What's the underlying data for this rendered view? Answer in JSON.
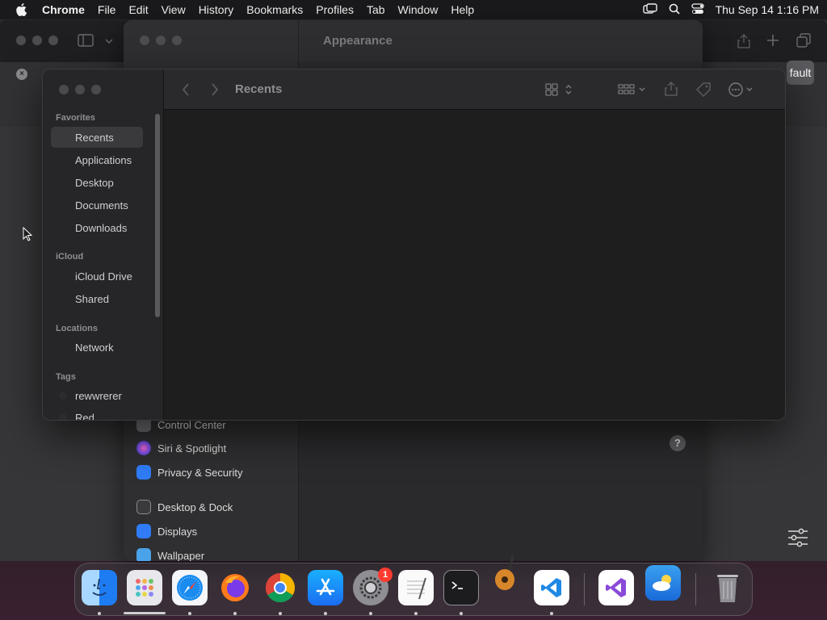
{
  "menubar": {
    "app_name": "Chrome",
    "items": [
      "File",
      "Edit",
      "View",
      "History",
      "Bookmarks",
      "Profiles",
      "Tab",
      "Window",
      "Help"
    ],
    "clock": "Thu Sep 14  1:16 PM"
  },
  "chrome": {
    "partial_button_label": "fault"
  },
  "settings": {
    "title": "Appearance",
    "sidebar_items": [
      {
        "label": "Control Center",
        "icon": "control-center-icon",
        "color": "#6e6e73"
      },
      {
        "label": "Siri & Spotlight",
        "icon": "siri-icon",
        "color": "#b14bd6"
      },
      {
        "label": "Privacy & Security",
        "icon": "hand-icon",
        "color": "#2f7cf6"
      },
      {
        "label": "Desktop & Dock",
        "icon": "dock-icon",
        "color": "#3a3a3c"
      },
      {
        "label": "Displays",
        "icon": "displays-icon",
        "color": "#2f7cf6"
      },
      {
        "label": "Wallpaper",
        "icon": "wallpaper-icon",
        "color": "#4aa3e8"
      }
    ],
    "help_label": "?"
  },
  "finder": {
    "title": "Recents",
    "sections": {
      "favorites": "Favorites",
      "icloud": "iCloud",
      "locations": "Locations",
      "tags": "Tags"
    },
    "favorites": [
      "Recents",
      "Applications",
      "Desktop",
      "Documents",
      "Downloads"
    ],
    "icloud": [
      "iCloud Drive",
      "Shared"
    ],
    "locations": [
      "Network"
    ],
    "tags": [
      "rewwrerer",
      "Red"
    ]
  },
  "dock": {
    "apps": [
      "Finder",
      "Launchpad",
      "Safari",
      "Firefox",
      "Chrome",
      "App Store",
      "System Settings",
      "TextEdit",
      "Terminal",
      "GarageBand",
      "Visual Studio Code",
      "Visual Studio",
      "Weather",
      "Trash"
    ],
    "settings_badge": "1"
  },
  "colors": {
    "accent": "#2f7cf6",
    "badge": "#ff3b30"
  }
}
